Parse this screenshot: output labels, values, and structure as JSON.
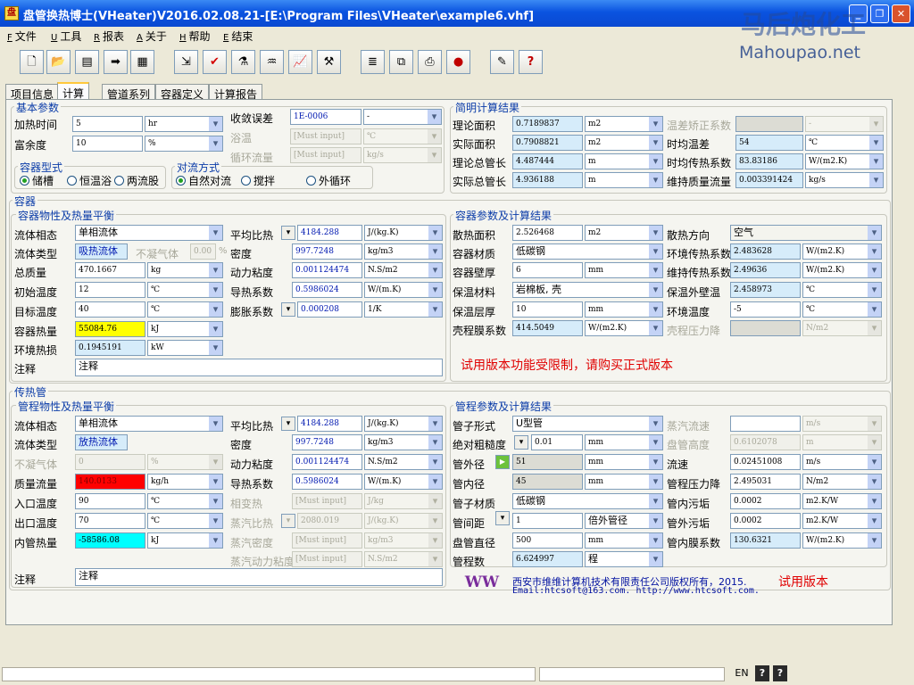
{
  "window": {
    "title": "盘管换热博士(VHeater)V2016.02.08.21-[E:\\Program Files\\VHeater\\example6.vhf]"
  },
  "watermark": {
    "cn": "马后炮化工",
    "url": "Mahoupao.net"
  },
  "menu": [
    {
      "key": "F",
      "label": "文件"
    },
    {
      "key": "U",
      "label": "工具"
    },
    {
      "key": "R",
      "label": "报表"
    },
    {
      "key": "A",
      "label": "关于"
    },
    {
      "key": "H",
      "label": "帮助"
    },
    {
      "key": "E",
      "label": "结束"
    }
  ],
  "toolbar_icons": [
    "new-file-icon",
    "open-folder-icon",
    "save-icon",
    "export-icon",
    "table-icon",
    "import-icon",
    "check-icon",
    "vessel-icon",
    "coil-icon",
    "chart-icon",
    "tools-icon",
    "report-icon",
    "copy-report-icon",
    "print-icon",
    "record-icon",
    "edit-icon",
    "help-icon"
  ],
  "tabs": [
    "项目信息",
    "计算",
    "管道系列",
    "容器定义",
    "计算报告"
  ],
  "basic": {
    "section": "基本参数",
    "heat_time": {
      "label": "加热时间",
      "value": "5",
      "unit": "hr"
    },
    "margin": {
      "label": "富余度",
      "value": "10",
      "unit": "%"
    },
    "tolerance": {
      "label": "收敛误差",
      "value": "1E-0006",
      "unit": "-"
    },
    "bath_temp": {
      "label": "浴温",
      "value": "[Must input]",
      "unit": "℃"
    },
    "circ_flow": {
      "label": "循环流量",
      "value": "[Must input]",
      "unit": "kg/s"
    },
    "vessel_type": {
      "title": "容器型式",
      "options": [
        "储槽",
        "恒温浴",
        "两流股"
      ],
      "selected": 0
    },
    "convection": {
      "title": "对流方式",
      "options": [
        "自然对流",
        "搅拌",
        "外循环"
      ],
      "selected": 0
    }
  },
  "brief": {
    "section": "简明计算结果",
    "rows": [
      {
        "label": "理论面积",
        "value": "0.7189837",
        "unit": "m2"
      },
      {
        "label": "实际面积",
        "value": "0.7908821",
        "unit": "m2"
      },
      {
        "label": "理论总管长",
        "value": "4.487444",
        "unit": "m"
      },
      {
        "label": "实际总管长",
        "value": "4.936188",
        "unit": "m"
      }
    ],
    "rows2": [
      {
        "label": "温差矫正系数",
        "value": "",
        "unit": "-"
      },
      {
        "label": "时均温差",
        "value": "54",
        "unit": "℃"
      },
      {
        "label": "时均传热系数",
        "value": "83.83186",
        "unit": "W/(m2.K)"
      },
      {
        "label": "维持质量流量",
        "value": "0.003391424",
        "unit": "kg/s"
      }
    ]
  },
  "vessel": {
    "section": "容器",
    "props_title": "容器物性及热量平衡",
    "phase": {
      "label": "流体相态",
      "value": "单相流体"
    },
    "fluid_type": {
      "label": "流体类型",
      "value": "吸热流体"
    },
    "noncond": {
      "label": "不凝气体",
      "value": "0.00",
      "unit": "%"
    },
    "mass": {
      "label": "总质量",
      "value": "470.1667",
      "unit": "kg"
    },
    "init_temp": {
      "label": "初始温度",
      "value": "12",
      "unit": "℃"
    },
    "target_temp": {
      "label": "目标温度",
      "value": "40",
      "unit": "℃"
    },
    "heat": {
      "label": "容器热量",
      "value": "55084.76",
      "unit": "kJ"
    },
    "loss": {
      "label": "环境热损",
      "value": "0.1945191",
      "unit": "kW"
    },
    "cp": {
      "label": "平均比热",
      "value": "4184.288",
      "unit": "J/(kg.K)"
    },
    "density": {
      "label": "密度",
      "value": "997.7248",
      "unit": "kg/m3"
    },
    "viscosity": {
      "label": "动力粘度",
      "value": "0.001124474",
      "unit": "N.S/m2"
    },
    "conductivity": {
      "label": "导热系数",
      "value": "0.5986024",
      "unit": "W/(m.K)"
    },
    "expansion": {
      "label": "膨胀系数",
      "value": "0.000208",
      "unit": "1/K"
    },
    "note": {
      "label": "注释",
      "value": "注释"
    },
    "params_title": "容器参数及计算结果",
    "area": {
      "label": "散热面积",
      "value": "2.526468",
      "unit": "m2"
    },
    "material": {
      "label": "容器材质",
      "value": "低碳钢"
    },
    "wall": {
      "label": "容器壁厚",
      "value": "6",
      "unit": "mm"
    },
    "insul": {
      "label": "保温材料",
      "value": "岩棉板, 壳"
    },
    "insul_thk": {
      "label": "保温层厚",
      "value": "10",
      "unit": "mm"
    },
    "shell_coef": {
      "label": "壳程膜系数",
      "value": "414.5049",
      "unit": "W/(m2.K)"
    },
    "dir": {
      "label": "散热方向",
      "value": "空气"
    },
    "env_coef": {
      "label": "环境传热系数",
      "value": "2.483628",
      "unit": "W/(m2.K)"
    },
    "keep_coef": {
      "label": "维持传热系数",
      "value": "2.49636",
      "unit": "W/(m2.K)"
    },
    "out_temp": {
      "label": "保温外壁温",
      "value": "2.458973",
      "unit": "℃"
    },
    "env_temp": {
      "label": "环境温度",
      "value": "-5",
      "unit": "℃"
    },
    "shell_dp": {
      "label": "壳程压力降",
      "value": "",
      "unit": "N/m2"
    },
    "trial": "试用版本功能受限制，请购买正式版本"
  },
  "tube": {
    "section": "传热管",
    "props_title": "管程物性及热量平衡",
    "phase": {
      "label": "流体相态",
      "value": "单相流体"
    },
    "fluid_type": {
      "label": "流体类型",
      "value": "放热流体"
    },
    "noncond": {
      "label": "不凝气体",
      "value": "0",
      "unit": "%"
    },
    "flow": {
      "label": "质量流量",
      "value": "140.0133",
      "unit": "kg/h"
    },
    "in_temp": {
      "label": "入口温度",
      "value": "90",
      "unit": "℃"
    },
    "out_temp": {
      "label": "出口温度",
      "value": "70",
      "unit": "℃"
    },
    "heat": {
      "label": "内管热量",
      "value": "-58586.08",
      "unit": "kJ"
    },
    "cp": {
      "label": "平均比热",
      "value": "4184.288",
      "unit": "J/(kg.K)"
    },
    "density": {
      "label": "密度",
      "value": "997.7248",
      "unit": "kg/m3"
    },
    "viscosity": {
      "label": "动力粘度",
      "value": "0.001124474",
      "unit": "N.S/m2"
    },
    "conductivity": {
      "label": "导热系数",
      "value": "0.5986024",
      "unit": "W/(m.K)"
    },
    "latent": {
      "label": "相变热",
      "value": "[Must input]",
      "unit": "J/kg"
    },
    "steam_cp": {
      "label": "蒸汽比热",
      "value": "2080.019",
      "unit": "J/(kg.K)"
    },
    "steam_density": {
      "label": "蒸汽密度",
      "value": "[Must input]",
      "unit": "kg/m3"
    },
    "steam_visc": {
      "label": "蒸汽动力粘度",
      "value": "[Must input]",
      "unit": "N.S/m2"
    },
    "note": {
      "label": "注释",
      "value": "注释"
    },
    "params_title": "管程参数及计算结果",
    "form": {
      "label": "管子形式",
      "value": "U型管"
    },
    "rough": {
      "label": "绝对粗糙度",
      "value": "0.01",
      "unit": "mm"
    },
    "od": {
      "label": "管外径",
      "value": "51",
      "unit": "mm"
    },
    "id": {
      "label": "管内径",
      "value": "45",
      "unit": "mm"
    },
    "material": {
      "label": "管子材质",
      "value": "低碳钢"
    },
    "pitch": {
      "label": "管间距",
      "value": "1",
      "unit": "倍外管径"
    },
    "coil_d": {
      "label": "盘管直径",
      "value": "500",
      "unit": "mm"
    },
    "turns": {
      "label": "管程数",
      "value": "6.624997",
      "unit": "程"
    },
    "steam_flow": {
      "label": "蒸汽流速",
      "value": "",
      "unit": "m/s"
    },
    "coil_h": {
      "label": "盘管高度",
      "value": "0.6102078",
      "unit": "m"
    },
    "vel": {
      "label": "流速",
      "value": "0.02451008",
      "unit": "m/s"
    },
    "dp": {
      "label": "管程压力降",
      "value": "2.495031",
      "unit": "N/m2"
    },
    "in_foul": {
      "label": "管内污垢",
      "value": "0.0002",
      "unit": "m2.K/W"
    },
    "out_foul": {
      "label": "管外污垢",
      "value": "0.0002",
      "unit": "m2.K/W"
    },
    "film": {
      "label": "管内膜系数",
      "value": "130.6321",
      "unit": "W/(m2.K)"
    }
  },
  "company": {
    "name": "西安市维维计算机技术有限责任公司版权所有，2015.",
    "contact": "Email:htcsoft@163.com.   http://www.htcsoft.com.",
    "trial": "试用版本",
    "logo": "WW"
  },
  "status": {
    "lang": "EN"
  }
}
